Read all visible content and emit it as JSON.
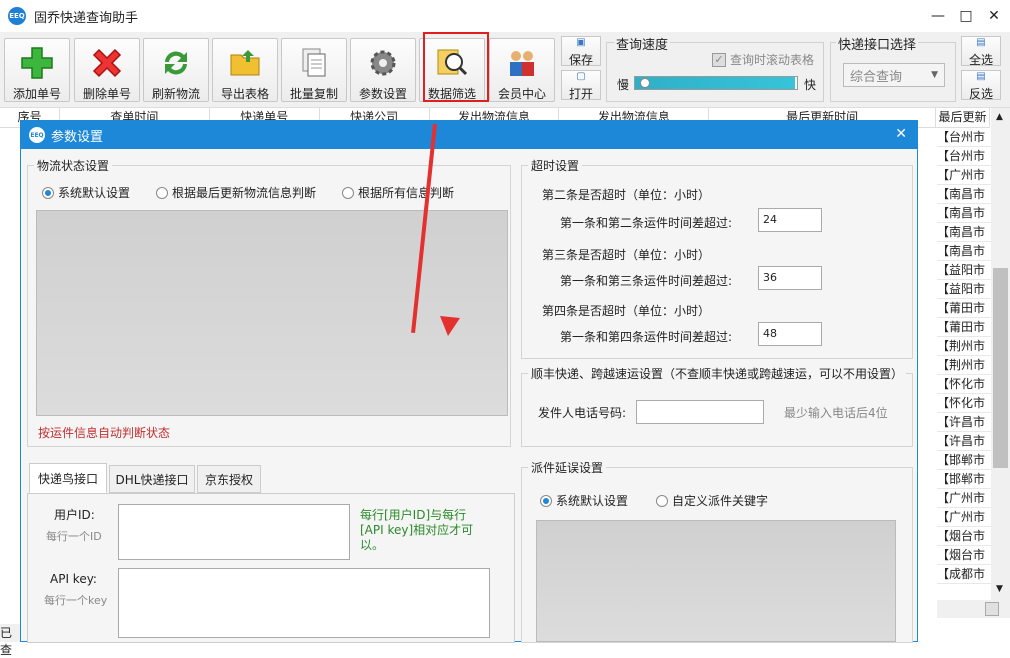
{
  "window": {
    "title": "固乔快递查询助手",
    "icon_text": "EEQ"
  },
  "toolbar": {
    "buttons": [
      {
        "label": "添加单号",
        "icon": "plus-icon"
      },
      {
        "label": "删除单号",
        "icon": "x-icon"
      },
      {
        "label": "刷新物流",
        "icon": "refresh-icon"
      },
      {
        "label": "导出表格",
        "icon": "folder-icon"
      },
      {
        "label": "批量复制",
        "icon": "copy-icon"
      },
      {
        "label": "参数设置",
        "icon": "gear-icon"
      },
      {
        "label": "数据筛选",
        "icon": "magnifier-icon"
      },
      {
        "label": "会员中心",
        "icon": "users-icon"
      }
    ],
    "save_label": "保存",
    "open_label": "打开",
    "speed_group": "查询速度",
    "scroll_check": "查询时滚动表格",
    "slow": "慢",
    "fast": "快",
    "speed_level": 0.02,
    "interface_group": "快递接口选择",
    "interface_value": "综合查询",
    "select_all": "全选",
    "invert": "反选"
  },
  "grid": {
    "headers": [
      "序号",
      "查单时间",
      "快递单号",
      "快递公司",
      "发出物流信息",
      "发出物流信息",
      "最后更新时间",
      "最后更新"
    ],
    "last_col": [
      "【台州市",
      "【台州市",
      "【广州市",
      "【南昌市",
      "【南昌市",
      "【南昌市",
      "【南昌市",
      "【益阳市",
      "【益阳市",
      "【莆田市",
      "【莆田市",
      "【荆州市",
      "【荆州市",
      "【怀化市",
      "【怀化市",
      "【许昌市",
      "【许昌市",
      "【邯郸市",
      "【邯郸市",
      "【广州市",
      "【广州市",
      "【烟台市",
      "【烟台市",
      "【成都市"
    ]
  },
  "status_left": "已查",
  "dialog": {
    "title": "参数设置",
    "logistics": {
      "legend": "物流状态设置",
      "opt1": "系统默认设置",
      "opt2": "根据最后更新物流信息判断",
      "opt3": "根据所有信息判断",
      "note": "按运件信息自动判断状态"
    },
    "timeout": {
      "legend": "超时设置",
      "sec2": "第二条是否超时（单位：小时）",
      "row2": "第一条和第二条运件时间差超过:",
      "val2": "24",
      "sec3": "第三条是否超时（单位：小时）",
      "row3": "第一条和第三条运件时间差超过:",
      "val3": "36",
      "sec4": "第四条是否超时（单位：小时）",
      "row4": "第一条和第四条运件时间差超过:",
      "val4": "48"
    },
    "sf": {
      "legend": "顺丰快递、跨越速运设置（不查顺丰快递或跨越速运，可以不用设置）",
      "phone_label": "发件人电话号码:",
      "phone_hint": "最少输入电话后4位"
    },
    "tabs": [
      "快递鸟接口",
      "DHL快递接口",
      "京东授权"
    ],
    "kdn": {
      "userid_label": "用户ID:",
      "userid_sub": "每行一个ID",
      "note": "每行[用户ID]与每行[API key]相对应才可以。",
      "apikey_label": "API key:",
      "apikey_sub": "每行一个key"
    },
    "dispatch": {
      "legend": "派件延误设置",
      "opt1": "系统默认设置",
      "opt2": "自定义派件关键字"
    }
  }
}
